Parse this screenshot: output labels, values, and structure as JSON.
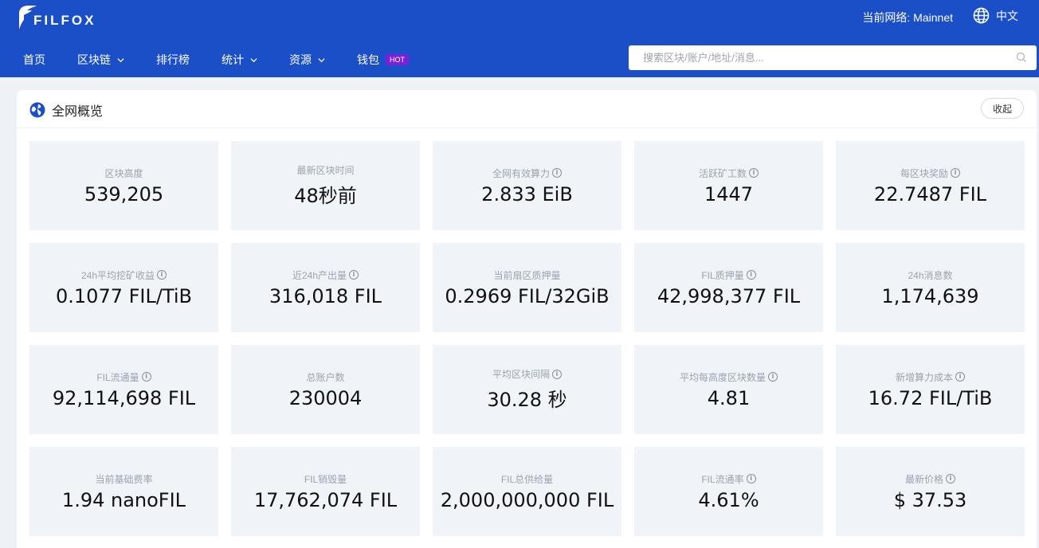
{
  "header": {
    "logo_text": "FILFOX",
    "network": "当前网络: Mainnet",
    "language": "中文",
    "nav": [
      {
        "label": "首页",
        "dropdown": false,
        "hot": false
      },
      {
        "label": "区块链",
        "dropdown": true,
        "hot": false
      },
      {
        "label": "排行榜",
        "dropdown": false,
        "hot": false
      },
      {
        "label": "统计",
        "dropdown": true,
        "hot": false
      },
      {
        "label": "资源",
        "dropdown": true,
        "hot": false
      },
      {
        "label": "钱包",
        "dropdown": false,
        "hot": true
      }
    ],
    "hot_badge": "HOT",
    "search_placeholder": "搜索区块/账户/地址/消息..."
  },
  "overview": {
    "title": "全网概览",
    "collapse_label": "收起",
    "cards": [
      {
        "label": "区块高度",
        "value": "539,205",
        "info": false
      },
      {
        "label": "最新区块时间",
        "value": "48秒前",
        "info": false
      },
      {
        "label": "全网有效算力",
        "value": "2.833 EiB",
        "info": true
      },
      {
        "label": "活跃矿工数",
        "value": "1447",
        "info": true
      },
      {
        "label": "每区块奖励",
        "value": "22.7487 FIL",
        "info": true
      },
      {
        "label": "24h平均挖矿收益",
        "value": "0.1077 FIL/TiB",
        "info": true
      },
      {
        "label": "近24h产出量",
        "value": "316,018 FIL",
        "info": true
      },
      {
        "label": "当前扇区质押量",
        "value": "0.2969 FIL/32GiB",
        "info": false
      },
      {
        "label": "FIL质押量",
        "value": "42,998,377 FIL",
        "info": true
      },
      {
        "label": "24h消息数",
        "value": "1,174,639",
        "info": false
      },
      {
        "label": "FIL流通量",
        "value": "92,114,698 FIL",
        "info": true
      },
      {
        "label": "总账户数",
        "value": "230004",
        "info": false
      },
      {
        "label": "平均区块间隔",
        "value": "30.28 秒",
        "info": true
      },
      {
        "label": "平均每高度区块数量",
        "value": "4.81",
        "info": true
      },
      {
        "label": "新增算力成本",
        "value": "16.72 FIL/TiB",
        "info": true
      },
      {
        "label": "当前基础费率",
        "value": "1.94 nanoFIL",
        "info": false
      },
      {
        "label": "FIL销毁量",
        "value": "17,762,074 FIL",
        "info": false
      },
      {
        "label": "FIL总供给量",
        "value": "2,000,000,000 FIL",
        "info": false
      },
      {
        "label": "FIL流通率",
        "value": "4.61%",
        "info": true
      },
      {
        "label": "最新价格",
        "value": "$ 37.53",
        "info": true
      }
    ]
  },
  "colors": {
    "header_bg": "#1a4fc8",
    "card_bg": "#f0f4f9",
    "hot_badge": "#7b1fd8"
  }
}
